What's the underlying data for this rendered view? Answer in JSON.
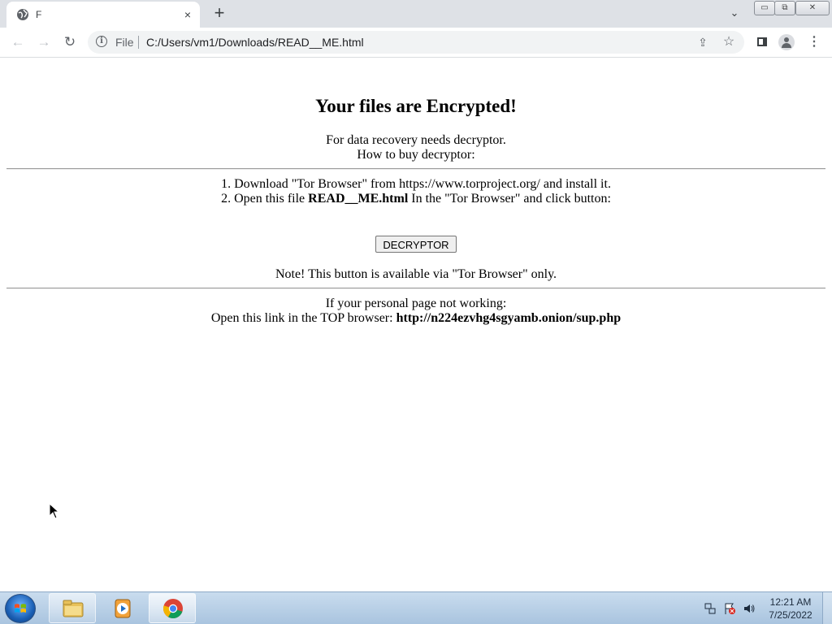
{
  "browser": {
    "tab": {
      "title": "F",
      "close_symbol": "×"
    },
    "new_tab_symbol": "+",
    "tab_search_symbol": "⌄",
    "window_controls": {
      "minimize": "▭",
      "maximize": "⧉",
      "close": "✕"
    },
    "nav": {
      "back": "←",
      "forward": "→",
      "reload": "↻"
    },
    "address_bar": {
      "scheme_label": "File",
      "url": "C:/Users/vm1/Downloads/READ__ME.html"
    },
    "icons": {
      "share": "⇪",
      "bookmark": "☆",
      "menu": "⋮"
    }
  },
  "page": {
    "heading": "Your files are Encrypted!",
    "intro_line1": "For data recovery needs decryptor.",
    "intro_line2": "How to buy decryptor:",
    "steps": [
      {
        "number": "1.",
        "text": "Download \"Tor Browser\" from https://www.torproject.org/ and install it."
      },
      {
        "number": "2.",
        "text_before": "Open this file ",
        "bold": "READ__ME.html",
        "text_after": " In the \"Tor Browser\" and click button:"
      }
    ],
    "button_label": "DECRYPTOR",
    "note": "Note! This button is available via \"Tor Browser\" only.",
    "fallback_line1": "If your personal page not working:",
    "fallback_line2_prefix": "Open this link in the TOP browser: ",
    "fallback_link": "http://n224ezvhg4sgyamb.onion/sup.php"
  },
  "taskbar": {
    "clock_time": "12:21 AM",
    "clock_date": "7/25/2022",
    "apps": [
      "windows-explorer",
      "windows-media-player",
      "google-chrome"
    ]
  },
  "colors": {
    "tabbar_bg": "#dee1e6",
    "omnibox_bg": "#f1f3f4",
    "taskbar_bg": "#b5cde6"
  }
}
